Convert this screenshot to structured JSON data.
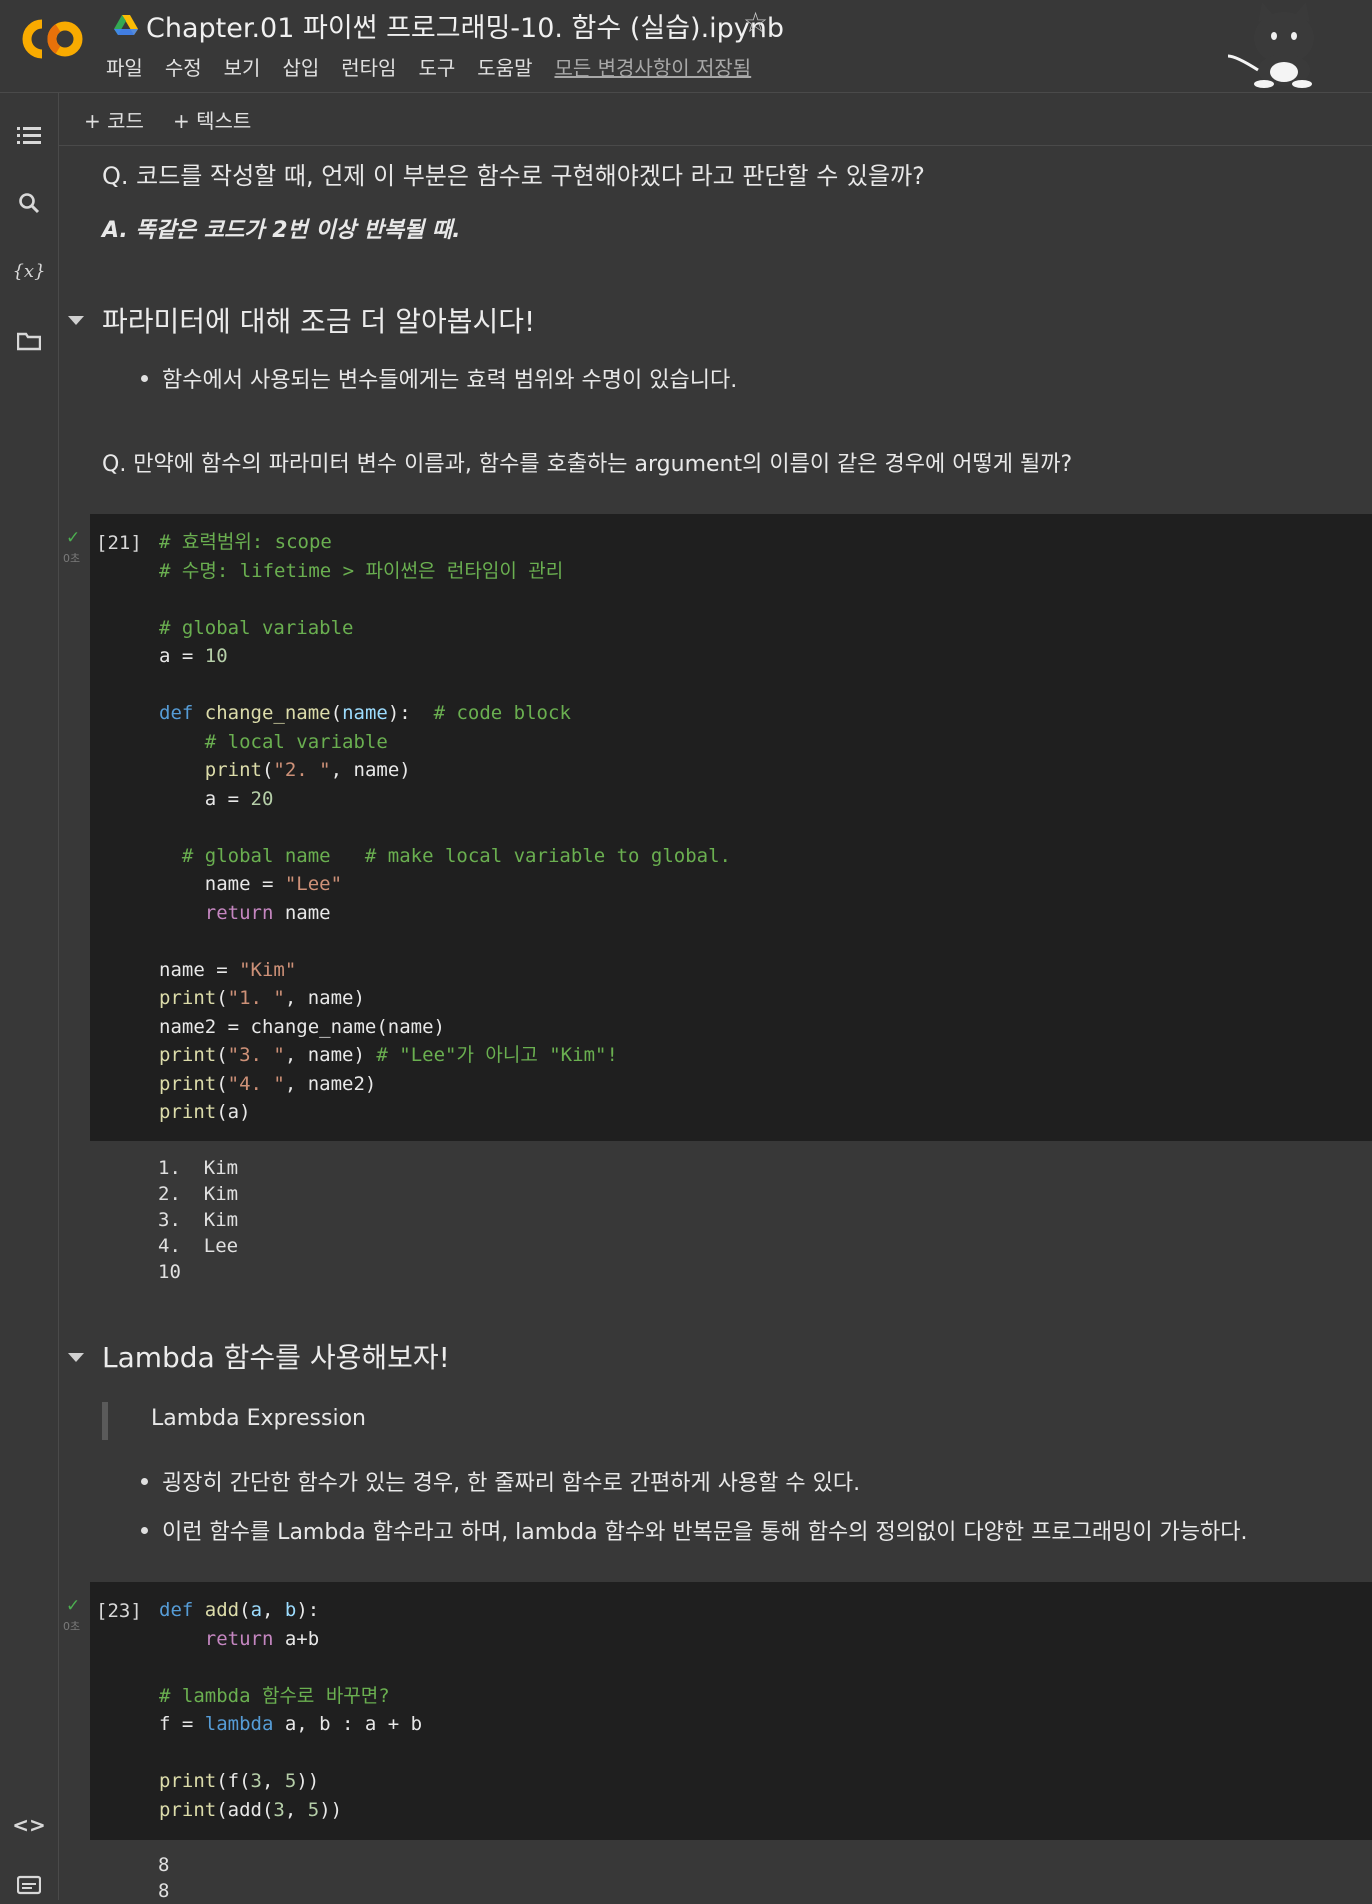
{
  "header": {
    "title": "Chapter.01 파이썬 프로그래밍-10. 함수 (실습).ipynb",
    "menu": [
      "파일",
      "수정",
      "보기",
      "삽입",
      "런타임",
      "도구",
      "도움말"
    ],
    "save_status": "모든 변경사항이 저장됨"
  },
  "toolbar": {
    "add_code": "+ 코드",
    "add_text": "+ 텍스트"
  },
  "content": {
    "question1": "Q. 코드를 작성할 때, 언제 이 부분은 함수로 구현해야겠다 라고 판단할 수 있을까?",
    "answer1": "A. 똑같은 코드가 2번 이상 반복될 때.",
    "section1_heading": "파라미터에 대해 조금 더 알아봅시다!",
    "section1_bullet": "함수에서 사용되는 변수들에게는 효력 범위와 수명이 있습니다.",
    "question2": "Q. 만약에 함수의 파라미터 변수 이름과, 함수를 호출하는 argument의 이름이 같은 경우에 어떻게 될까?",
    "section2_heading": "Lambda 함수를 사용해보자!",
    "section2_quote": "Lambda Expression",
    "section2_bullet1": "굉장히 간단한 함수가 있는 경우, 한 줄짜리 함수로 간편하게 사용할 수 있다.",
    "section2_bullet2": "이런 함수를 Lambda 함수라고 하며, lambda 함수와 반복문을 통해 함수의 정의없이 다양한 프로그래밍이 가능하다."
  },
  "cell1": {
    "exec_count": "[21]",
    "exec_time": "0초",
    "lines": [
      "# 효력범위: scope",
      "# 수명: lifetime > 파이썬은 런타임이 관리",
      "",
      "# global variable",
      "a = 10",
      "",
      "def change_name(name):  # code block",
      "    # local variable",
      "    print(\"2. \", name)",
      "    a = 20",
      "",
      "  # global name   # make local variable to global.",
      "    name = \"Lee\"",
      "    return name",
      "",
      "name = \"Kim\"",
      "print(\"1. \", name)",
      "name2 = change_name(name)",
      "print(\"3. \", name) # \"Lee\"가 아니고 \"Kim\"!",
      "print(\"4. \", name2)",
      "print(a)"
    ],
    "output": [
      "1.  Kim",
      "2.  Kim",
      "3.  Kim",
      "4.  Lee",
      "10"
    ]
  },
  "cell2": {
    "exec_count": "[23]",
    "exec_time": "0초",
    "lines": [
      "def add(a, b):",
      "    return a+b",
      "",
      "# lambda 함수로 바꾸면?",
      "f = lambda a, b : a + b",
      "",
      "print(f(3, 5))",
      "print(add(3, 5))"
    ],
    "output": [
      "8",
      "8"
    ]
  }
}
